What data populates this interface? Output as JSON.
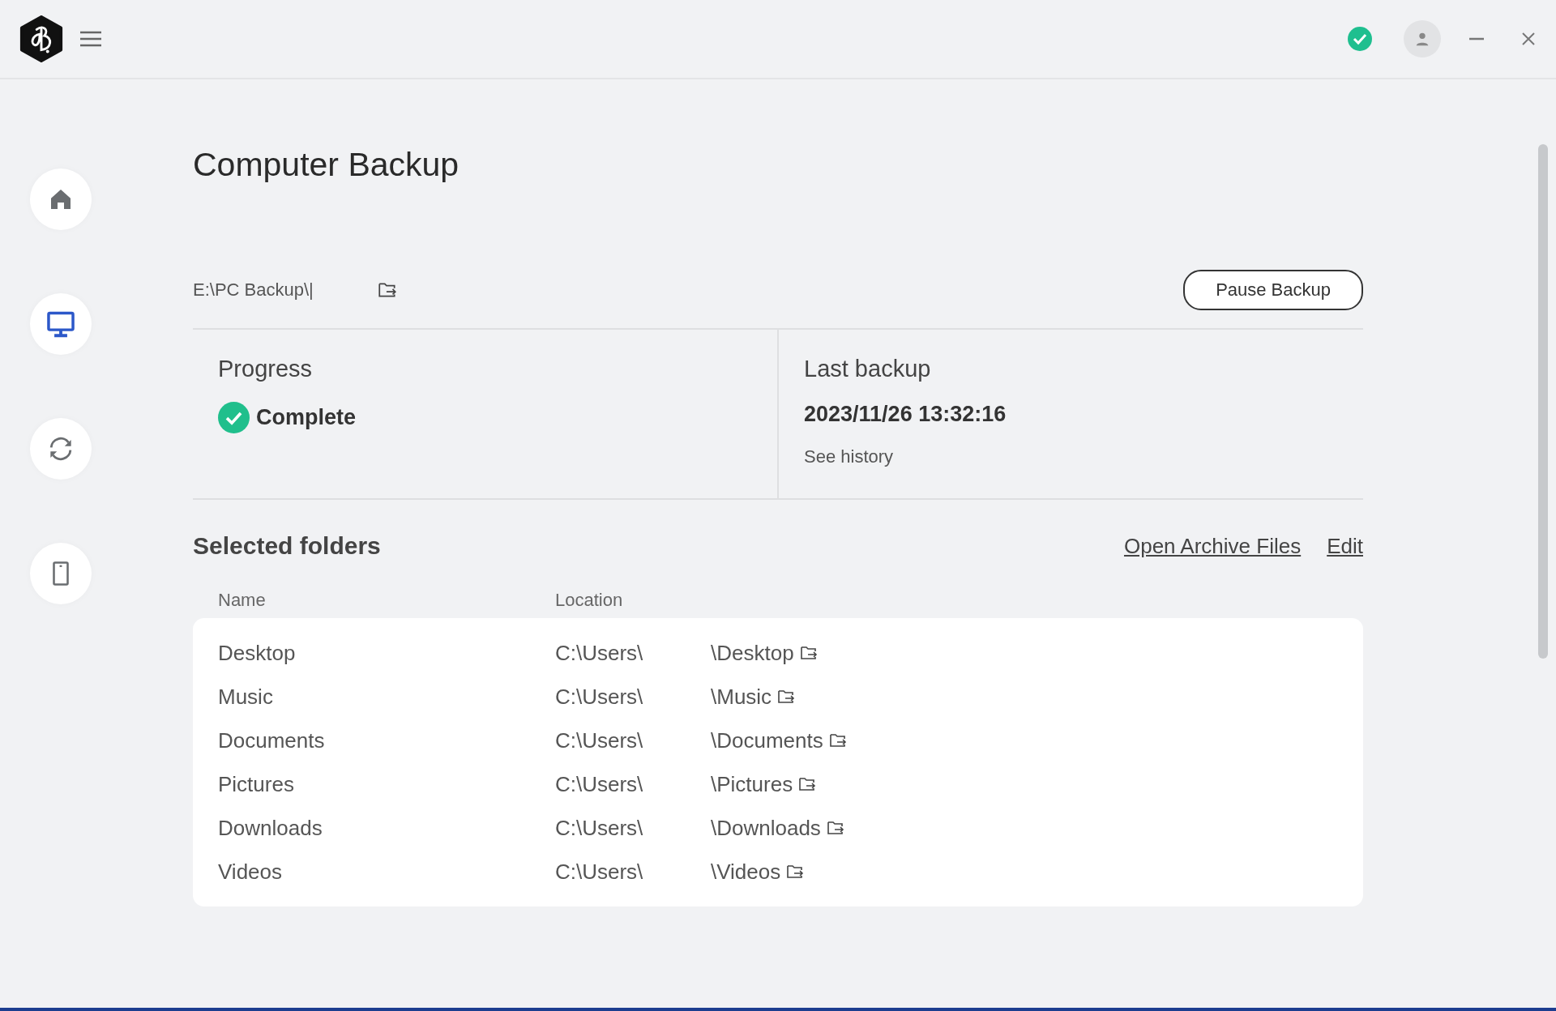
{
  "nav": [
    {
      "kind": "home",
      "selected": false
    },
    {
      "kind": "computer",
      "selected": true
    },
    {
      "kind": "sync",
      "selected": false
    },
    {
      "kind": "phone",
      "selected": false
    }
  ],
  "title": "Computer Backup",
  "destination": "E:\\PC Backup\\|",
  "pause_button": "Pause Backup",
  "progress": {
    "label": "Progress",
    "status": "Complete"
  },
  "last_backup": {
    "label": "Last backup",
    "time": "2023/11/26 13:32:16",
    "link": "See history"
  },
  "folders": {
    "title": "Selected folders",
    "links": [
      "Open Archive Files",
      "Edit"
    ],
    "columns": [
      "Name",
      "Location"
    ],
    "rows": [
      {
        "name": "Desktop",
        "location": "C:\\Users\\",
        "folder": "\\Desktop"
      },
      {
        "name": "Music",
        "location": "C:\\Users\\",
        "folder": "\\Music"
      },
      {
        "name": "Documents",
        "location": "C:\\Users\\",
        "folder": "\\Documents"
      },
      {
        "name": "Pictures",
        "location": "C:\\Users\\",
        "folder": "\\Pictures"
      },
      {
        "name": "Downloads",
        "location": "C:\\Users\\",
        "folder": "\\Downloads"
      },
      {
        "name": "Videos",
        "location": "C:\\Users\\",
        "folder": "\\Videos"
      }
    ]
  }
}
